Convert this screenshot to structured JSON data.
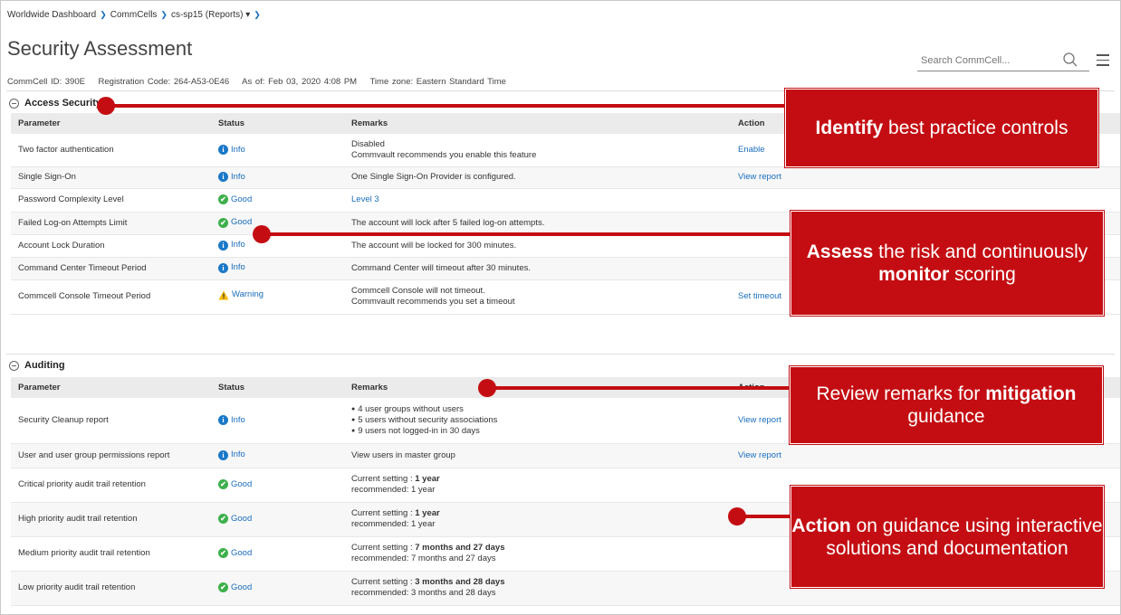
{
  "breadcrumb": [
    "Worldwide Dashboard",
    "CommCells",
    "cs-sp15 (Reports) ▾"
  ],
  "page_title": "Security Assessment",
  "meta": {
    "commcell_id": "CommCell ID: 390E",
    "registration_code": "Registration Code: 264-A53-0E46",
    "as_of": "As of: Feb 03, 2020 4:08 PM",
    "time_zone": "Time zone: Eastern Standard Time"
  },
  "search": {
    "placeholder": "Search CommCell..."
  },
  "icons": {
    "search": "search-icon",
    "menu": "hamburger-menu-icon",
    "collapse": "collapse-circle-icon",
    "info": "info-icon",
    "good": "check-circle-icon",
    "warning": "warning-triangle-icon"
  },
  "colors": {
    "accent_red": "#c40d12",
    "link_blue": "#1a6dbd",
    "good_green": "#3db04b",
    "warning_yellow": "#f5b800"
  },
  "columns": {
    "parameter": "Parameter",
    "status": "Status",
    "remarks": "Remarks",
    "action": "Action"
  },
  "access_security": {
    "title": "Access Security",
    "rows": [
      {
        "parameter": "Two factor authentication",
        "status": "Info",
        "remarks": [
          "Disabled",
          "Commvault recommends you enable this feature"
        ],
        "action": "Enable"
      },
      {
        "parameter": "Single Sign-On",
        "status": "Info",
        "remarks": [
          "One Single Sign-On Provider is configured."
        ],
        "action": "View report"
      },
      {
        "parameter": "Password Complexity Level",
        "status": "Good",
        "remarks_link": "Level 3",
        "action": ""
      },
      {
        "parameter": "Failed Log-on Attempts Limit",
        "status": "Good",
        "remarks": [
          "The account will lock after 5 failed log-on attempts."
        ],
        "action": ""
      },
      {
        "parameter": "Account Lock Duration",
        "status": "Info",
        "remarks": [
          "The account will be locked for 300 minutes."
        ],
        "action": ""
      },
      {
        "parameter": "Command Center Timeout Period",
        "status": "Info",
        "remarks": [
          "Command Center will timeout after 30 minutes."
        ],
        "action": ""
      },
      {
        "parameter": "Commcell Console Timeout Period",
        "status": "Warning",
        "remarks": [
          "Commcell Console will not timeout.",
          "Commvault recommends you set a timeout"
        ],
        "action": "Set timeout"
      }
    ]
  },
  "auditing": {
    "title": "Auditing",
    "rows": [
      {
        "parameter": "Security Cleanup report",
        "status": "Info",
        "bullets": [
          "4 user groups without users",
          "5 users without security associations",
          "9 users not logged-in in 30 days"
        ],
        "action": "View report"
      },
      {
        "parameter": "User and user group permissions report",
        "status": "Info",
        "remarks": [
          "View users in master group"
        ],
        "action": "View report"
      },
      {
        "parameter": "Critical priority audit trail retention",
        "status": "Good",
        "current_label": "Current setting : ",
        "current": "1 year",
        "recommended": "recommended: 1 year",
        "action": ""
      },
      {
        "parameter": "High priority audit trail retention",
        "status": "Good",
        "current_label": "Current setting : ",
        "current": "1 year",
        "recommended": "recommended: 1 year",
        "action": ""
      },
      {
        "parameter": "Medium priority audit trail retention",
        "status": "Good",
        "current_label": "Current setting : ",
        "current": "7 months and 27 days",
        "recommended": "recommended: 7 months and 27 days",
        "action": ""
      },
      {
        "parameter": "Low priority audit trail retention",
        "status": "Good",
        "current_label": "Current setting : ",
        "current": "3 months and 28 days",
        "recommended": "recommended: 3 months and 28 days",
        "action": ""
      }
    ]
  },
  "callouts": [
    {
      "bold": "Identify",
      "text": " best practice controls"
    },
    {
      "bold1": "Assess",
      "text1": " the risk and continuously ",
      "bold2": "monitor",
      "text2": " scoring"
    },
    {
      "text": "Review remarks for ",
      "bold": "mitigation",
      "text2": " guidance"
    },
    {
      "bold": "Action",
      "text": " on guidance using interactive solutions and documentation"
    }
  ]
}
